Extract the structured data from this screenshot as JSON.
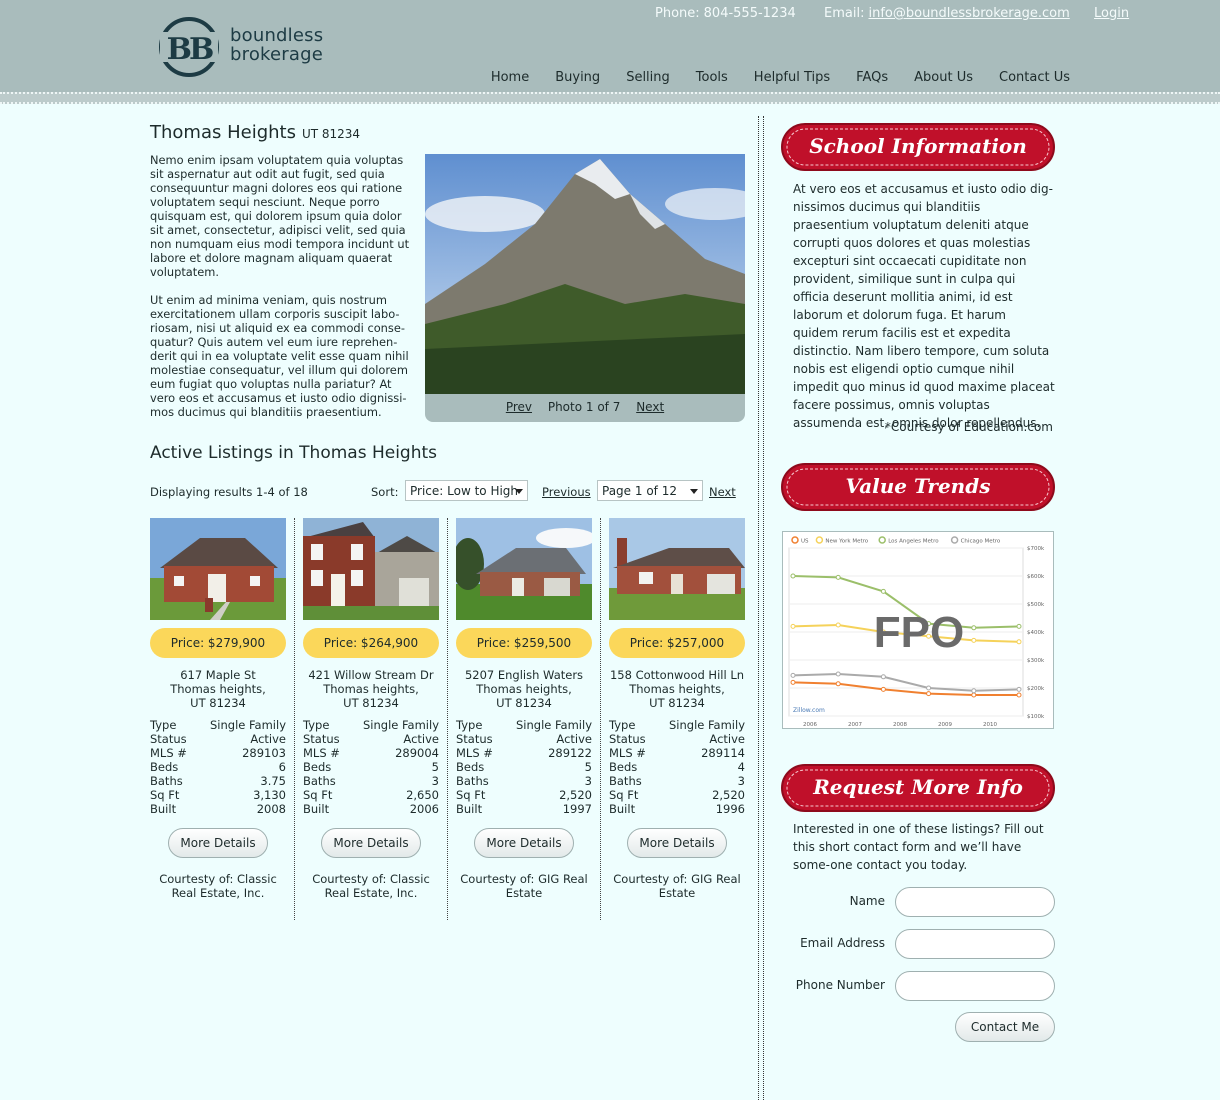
{
  "header": {
    "logo": {
      "mark": "BB",
      "line1": "boundless",
      "line2": "brokerage"
    },
    "phone_label": "Phone:",
    "phone": "804-555-1234",
    "email_label": "Email:",
    "email": "info@boundlessbrokerage.com",
    "login": "Login",
    "nav": [
      "Home",
      "Buying",
      "Selling",
      "Tools",
      "Helpful Tips",
      "FAQs",
      "About Us",
      "Contact Us"
    ]
  },
  "property": {
    "name": "Thomas Heights",
    "zip": "UT 81234",
    "paragraphs": [
      "Nemo enim ipsam voluptatem quia voluptas sit aspernatur aut odit aut fugit, sed quia consequuntur magni dolores eos qui ratione voluptatem sequi nesciunt. Neque porro quisquam est, qui dolorem ipsum quia dolor sit amet, consectetur, adipisci velit, sed quia non numquam eius modi tempora incidunt ut labore et dolore magnam aliquam quaerat voluptatem.",
      "Ut enim ad minima veniam, quis nostrum exercitationem ullam corporis suscipit labo-riosam, nisi ut aliquid ex ea commodi conse-quatur? Quis autem vel eum iure reprehen-derit qui in ea voluptate velit esse quam nihil molestiae consequatur, vel illum qui dolorem eum fugiat quo voluptas nulla pariatur? At vero eos et accusamus et iusto odio dignissi-mos ducimus qui blanditiis praesentium."
    ],
    "photo_prev": "Prev",
    "photo_counter": "Photo 1 of 7",
    "photo_next": "Next"
  },
  "active": {
    "title": "Active Listings in Thomas Heights",
    "results": "Displaying results 1-4 of 18",
    "sort_label": "Sort:",
    "sort_value": "Price: Low to High",
    "previous": "Previous",
    "page_value": "Page 1 of 12",
    "next": "Next"
  },
  "spec_labels": [
    "Type",
    "Status",
    "MLS #",
    "Beds",
    "Baths",
    "Sq Ft",
    "Built"
  ],
  "more_details": "More Details",
  "listings": [
    {
      "price": "Price: $279,900",
      "street": "617 Maple St",
      "city": "Thomas heights,",
      "state": "UT 81234",
      "specs": [
        "Single Family",
        "Active",
        "289103",
        "6",
        "3.75",
        "3,130",
        "2008"
      ],
      "courtesy": "Courtesty of: Classic Real Estate, Inc."
    },
    {
      "price": "Price: $264,900",
      "street": "421 Willow Stream Dr",
      "city": "Thomas heights,",
      "state": "UT 81234",
      "specs": [
        "Single Family",
        "Active",
        "289004",
        "5",
        "3",
        "2,650",
        "2006"
      ],
      "courtesy": "Courtesty of: Classic Real Estate, Inc."
    },
    {
      "price": "Price: $259,500",
      "street": "5207 English Waters",
      "city": "Thomas heights,",
      "state": "UT 81234",
      "specs": [
        "Single Family",
        "Active",
        "289122",
        "5",
        "3",
        "2,520",
        "1997"
      ],
      "courtesy": "Courtesty of: GIG Real Estate"
    },
    {
      "price": "Price: $257,000",
      "street": "158 Cottonwood Hill Ln",
      "city": "Thomas heights,",
      "state": "UT 81234",
      "specs": [
        "Single Family",
        "Active",
        "289114",
        "4",
        "3",
        "2,520",
        "1996"
      ],
      "courtesy": "Courtesty of: GIG Real Estate"
    }
  ],
  "sidebar": {
    "school_title": "School Information",
    "school_text": "At vero eos et accusamus et iusto odio dig-nissimos ducimus qui blanditiis praesentium voluptatum deleniti atque corrupti quos dolores et quas molestias excepturi sint occaecati cupiditate non provident, similique sunt in culpa qui officia deserunt mollitia animi, id est laborum et dolorum fuga. Et harum quidem rerum facilis est et expedita distinctio. Nam libero tempore, cum soluta nobis est eligendi optio cumque nihil impedit quo minus id quod maxime placeat facere possimus, omnis voluptas assumenda est, omnis dolor repellendus.",
    "school_courtesy": "*Courtesy of Education.com",
    "value_title": "Value Trends",
    "chart_overlay": "FPO",
    "request_title": "Request More Info",
    "request_text": "Interested in one of these listings? Fill out this short contact form and we’ll have some-one contact you today.",
    "form": {
      "name": "Name",
      "email": "Email Address",
      "phone": "Phone Number",
      "submit": "Contact Me"
    }
  },
  "chart_data": {
    "type": "line",
    "legend": [
      "US",
      "New York Metro",
      "Los Angeles Metro",
      "Chicago Metro"
    ],
    "x": [
      "2006",
      "2007",
      "2008",
      "2009",
      "2010"
    ],
    "yticks": [
      "$700k",
      "$600k",
      "$500k",
      "$400k",
      "$300k",
      "$200k",
      "$100k"
    ],
    "ylim": [
      100,
      700
    ],
    "series": [
      {
        "name": "US",
        "color": "#f08030",
        "values": [
          220,
          215,
          195,
          180,
          175,
          175
        ]
      },
      {
        "name": "New York Metro",
        "color": "#f5d25a",
        "values": [
          420,
          425,
          400,
          385,
          370,
          365
        ]
      },
      {
        "name": "Los Angeles Metro",
        "color": "#9bbf6a",
        "values": [
          600,
          595,
          545,
          430,
          415,
          420
        ]
      },
      {
        "name": "Chicago Metro",
        "color": "#aaaaaa",
        "values": [
          245,
          250,
          240,
          200,
          190,
          195
        ]
      }
    ],
    "watermark": "Zillow.com"
  },
  "colors": {
    "header": "#a9bcbc",
    "background": "#eefefe",
    "banner": "#c0102a",
    "price_pill": "#fbd75a"
  }
}
